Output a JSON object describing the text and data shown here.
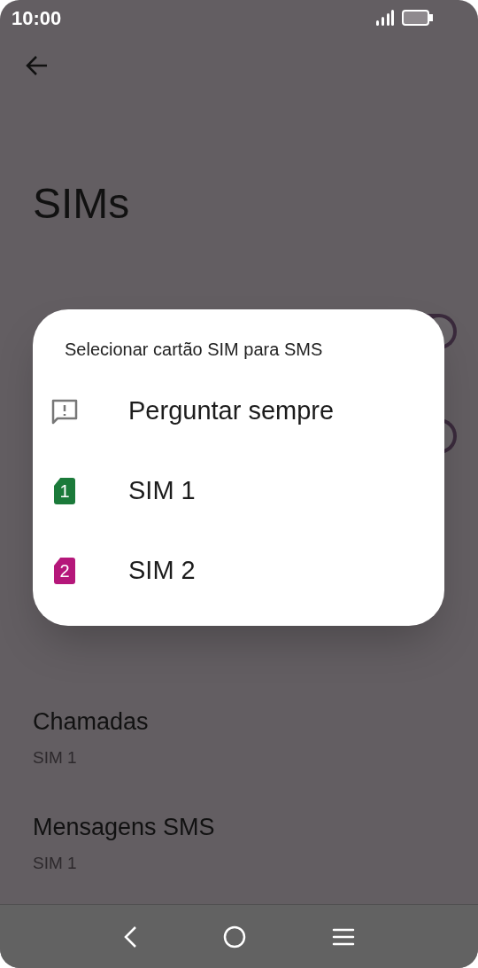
{
  "status_bar": {
    "time": "10:00"
  },
  "title": "SIMs",
  "toggles": [
    {
      "on": true
    },
    {
      "on": true
    }
  ],
  "settings": [
    {
      "label": "Chamadas",
      "value": "SIM 1"
    },
    {
      "label": "Mensagens SMS",
      "value": "SIM 1"
    }
  ],
  "dialog": {
    "title": "Selecionar cartão SIM para SMS",
    "options": [
      {
        "kind": "ask",
        "label": "Perguntar sempre"
      },
      {
        "kind": "sim",
        "badge": "1",
        "label": "SIM 1",
        "color": "#1b7a3a"
      },
      {
        "kind": "sim",
        "badge": "2",
        "label": "SIM 2",
        "color": "#b5177a"
      }
    ]
  }
}
